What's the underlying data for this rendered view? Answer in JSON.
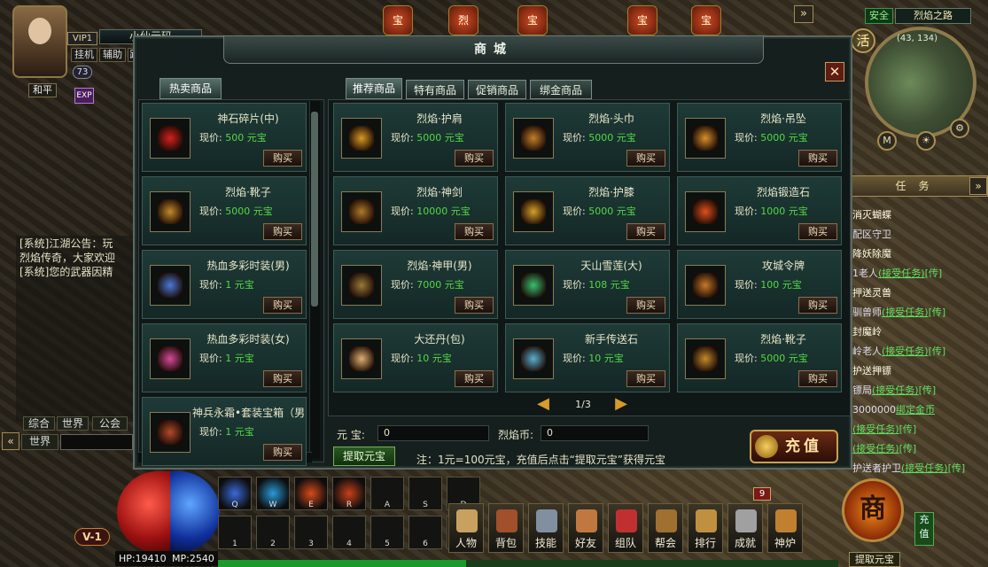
{
  "player": {
    "vip": "VIP1",
    "name": "小仙元码",
    "btn_hangup": "挂机",
    "btn_assist": "辅助",
    "btn_path": "路",
    "level": "73",
    "mode": "和平",
    "exp": "EXP"
  },
  "top_icons": [
    "宝",
    "烈",
    "宝",
    "宝",
    "宝"
  ],
  "minimap": {
    "safe": "安全",
    "map_name": "烈焰之路",
    "coord": "(43, 134)",
    "activity": "活",
    "btn_m": "M"
  },
  "tasks": {
    "title": "任务",
    "lines": [
      {
        "name": "消灭蝴蝶",
        "npc": "",
        "action": ""
      },
      {
        "name": "",
        "npc": "配区守卫",
        "action": ""
      },
      {
        "name": "降妖除魔",
        "npc": "",
        "action": ""
      },
      {
        "name": "",
        "npc": "1老人",
        "action": "(接受任务)",
        "tele": "[传]"
      },
      {
        "name": "押送灵兽",
        "npc": "",
        "action": ""
      },
      {
        "name": "",
        "npc": "驯兽师",
        "action": "(接受任务)",
        "tele": "[传]"
      },
      {
        "name": "封魔岭",
        "npc": "",
        "action": ""
      },
      {
        "name": "",
        "npc": "岭老人",
        "action": "(接受任务)",
        "tele": "[传]"
      },
      {
        "name": "护送押镖",
        "npc": "",
        "action": ""
      },
      {
        "name": "",
        "npc": "镖局",
        "action": "(接受任务)",
        "tele": "[传]"
      },
      {
        "name": "",
        "npc": "3000000",
        "action": "绑定金币",
        "tele": ""
      },
      {
        "name": "",
        "npc": "",
        "action": "(接受任务)",
        "tele": "[传]"
      },
      {
        "name": "",
        "npc": "",
        "action": "(接受任务)",
        "tele": "[传]"
      },
      {
        "name": "",
        "npc": "护送者护卫",
        "action": "(接受任务)",
        "tele": "[传]"
      }
    ]
  },
  "chat": {
    "lines": [
      "[系统]江湖公告：玩",
      "烈焰传奇，大家欢迎",
      "[系统]您的武器因精"
    ],
    "tabs": [
      "综合",
      "世界",
      "公会"
    ],
    "channel": "世界"
  },
  "bottom": {
    "hp": "HP:19410",
    "mp": "MP:2540",
    "vline": "V-1",
    "skill_keys": [
      "Q",
      "W",
      "E",
      "R",
      "A",
      "S",
      "D",
      "1",
      "2",
      "3",
      "4",
      "5",
      "6",
      "7"
    ],
    "menu": [
      "人物",
      "背包",
      "技能",
      "好友",
      "组队",
      "帮会",
      "排行",
      "成就",
      "神炉"
    ],
    "badge": "9",
    "shang": "商",
    "recharge_side": "充值",
    "withdraw_side": "提取元宝"
  },
  "shop": {
    "title": "商城",
    "left_tab": "热卖商品",
    "tabs": [
      "推荐商品",
      "特有商品",
      "促销商品",
      "绑金商品"
    ],
    "price_prefix": "现价:",
    "currency": "元宝",
    "buy": "购买",
    "hot_items": [
      {
        "name": "神石碎片(中)",
        "price": "500",
        "color": "#d8201a"
      },
      {
        "name": "烈焰·靴子",
        "price": "5000",
        "color": "#c48a2a"
      },
      {
        "name": "热血多彩时装(男)",
        "price": "1",
        "color": "#4a7ad8"
      },
      {
        "name": "热血多彩时装(女)",
        "price": "1",
        "color": "#d84a9a"
      },
      {
        "name": "神兵永霜•套装宝箱（男",
        "price": "1",
        "color": "#b24a2a"
      }
    ],
    "items": [
      {
        "name": "烈焰·护肩",
        "price": "5000",
        "color": "#d89a24"
      },
      {
        "name": "烈焰·头巾",
        "price": "5000",
        "color": "#c4802a"
      },
      {
        "name": "烈焰·吊坠",
        "price": "5000",
        "color": "#d8902a"
      },
      {
        "name": "烈焰·神剑",
        "price": "10000",
        "color": "#b0782a"
      },
      {
        "name": "烈焰·护膝",
        "price": "5000",
        "color": "#d8a02a"
      },
      {
        "name": "烈焰锻造石",
        "price": "1000",
        "color": "#e0501e"
      },
      {
        "name": "烈焰·神甲(男)",
        "price": "7000",
        "color": "#9a7a3a"
      },
      {
        "name": "天山雪莲(大)",
        "price": "108",
        "color": "#3ac070"
      },
      {
        "name": "攻城令牌",
        "price": "100",
        "color": "#c8782a"
      },
      {
        "name": "大还丹(包)",
        "price": "10",
        "color": "#e0b070"
      },
      {
        "name": "新手传送石",
        "price": "10",
        "color": "#5ab0d0"
      },
      {
        "name": "烈焰·靴子",
        "price": "5000",
        "color": "#c48a2a"
      }
    ],
    "page": "1/3",
    "yuanbao_label": "元  宝:",
    "yuanbao_value": "0",
    "lieyan_label": "烈焰币:",
    "lieyan_value": "0",
    "withdraw": "提取元宝",
    "note": "注：1元=100元宝，充值后点击“提取元宝”获得元宝",
    "recharge": "充值",
    "close": "✕"
  }
}
